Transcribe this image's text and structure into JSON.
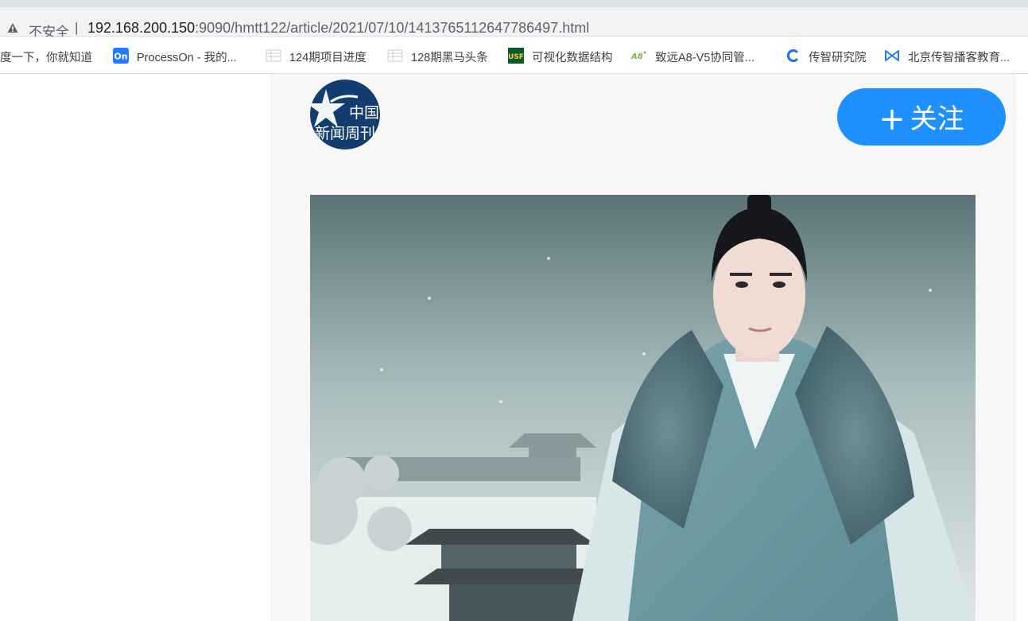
{
  "browser": {
    "security_label": "不安全",
    "url_host": "192.168.200.150",
    "url_path": ":9090/hmtt122/article/2021/07/10/1413765112647786497.html"
  },
  "bookmarks": [
    {
      "label": "度一下，你就知道",
      "icon": "baidu-icon"
    },
    {
      "label": "ProcessOn - 我的...",
      "icon": "processon-icon"
    },
    {
      "label": "124期项目进度",
      "icon": "spreadsheet-icon"
    },
    {
      "label": "128期黑马头条",
      "icon": "spreadsheet-icon"
    },
    {
      "label": "可视化数据结构",
      "icon": "usf-icon"
    },
    {
      "label": "致远A8-V5协同管...",
      "icon": "a8-icon"
    },
    {
      "label": "传智研究院",
      "icon": "chuanzhi-c-icon"
    },
    {
      "label": "北京传智播客教育...",
      "icon": "bowtie-logo-icon"
    }
  ],
  "article": {
    "author_logo": {
      "line1": "中国",
      "line2": "新闻周刊",
      "icon": "star-logo-icon"
    },
    "follow_label": "关注",
    "follow_plus": "+",
    "hero_image": "snowy-palace-portrait-image"
  },
  "colors": {
    "follow_button": "#1e90ff",
    "logo_bg": "#123d6e"
  }
}
